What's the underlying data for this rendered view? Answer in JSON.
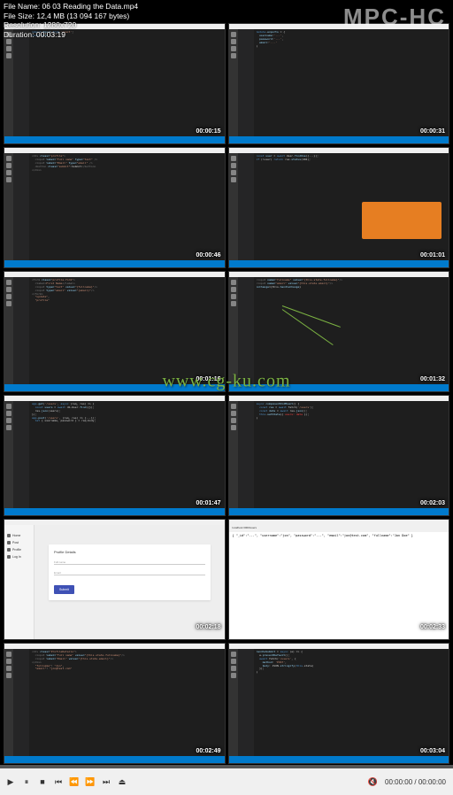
{
  "player_logo": "MPC-HC",
  "file_info": {
    "name_label": "File Name:",
    "name": "06 03 Reading the Data.mp4",
    "size_label": "File Size:",
    "size": "12,4 MB (13 094 167 bytes)",
    "resolution_label": "Resolution:",
    "resolution": "1280x720",
    "duration_label": "Duration:",
    "duration": "00:03:19"
  },
  "watermark": "www.cg-ku.com",
  "thumbs": [
    {
      "ts": "00:00:15",
      "type": "code"
    },
    {
      "ts": "00:00:31",
      "type": "code"
    },
    {
      "ts": "00:00:46",
      "type": "code-html"
    },
    {
      "ts": "00:01:01",
      "type": "code-orange"
    },
    {
      "ts": "00:01:16",
      "type": "code-html"
    },
    {
      "ts": "00:01:32",
      "type": "code-arrows"
    },
    {
      "ts": "00:01:47",
      "type": "code"
    },
    {
      "ts": "00:02:03",
      "type": "code"
    },
    {
      "ts": "00:02:18",
      "type": "form"
    },
    {
      "ts": "00:02:33",
      "type": "browser"
    },
    {
      "ts": "00:02:49",
      "type": "code-html"
    },
    {
      "ts": "00:03:04",
      "type": "code"
    }
  ],
  "form": {
    "sidebar_items": [
      "Home",
      "Post",
      "Profile",
      "Log In"
    ],
    "card_title": "Profile Details",
    "fields": [
      "Full name",
      "Email"
    ],
    "submit": "Submit"
  },
  "browser": {
    "url": "localhost:3000/users",
    "body": "{ \"_id\":\"...\", \"username\":\"jon\", \"password\":\"...\", \"email\":\"jon@test.com\", \"fullname\":\"Jon Doe\" }"
  },
  "controls": {
    "time": "00:00:00 / 00:00:00",
    "buttons": [
      "play",
      "stop",
      "prev",
      "rewind",
      "fwd",
      "next",
      "step"
    ]
  }
}
